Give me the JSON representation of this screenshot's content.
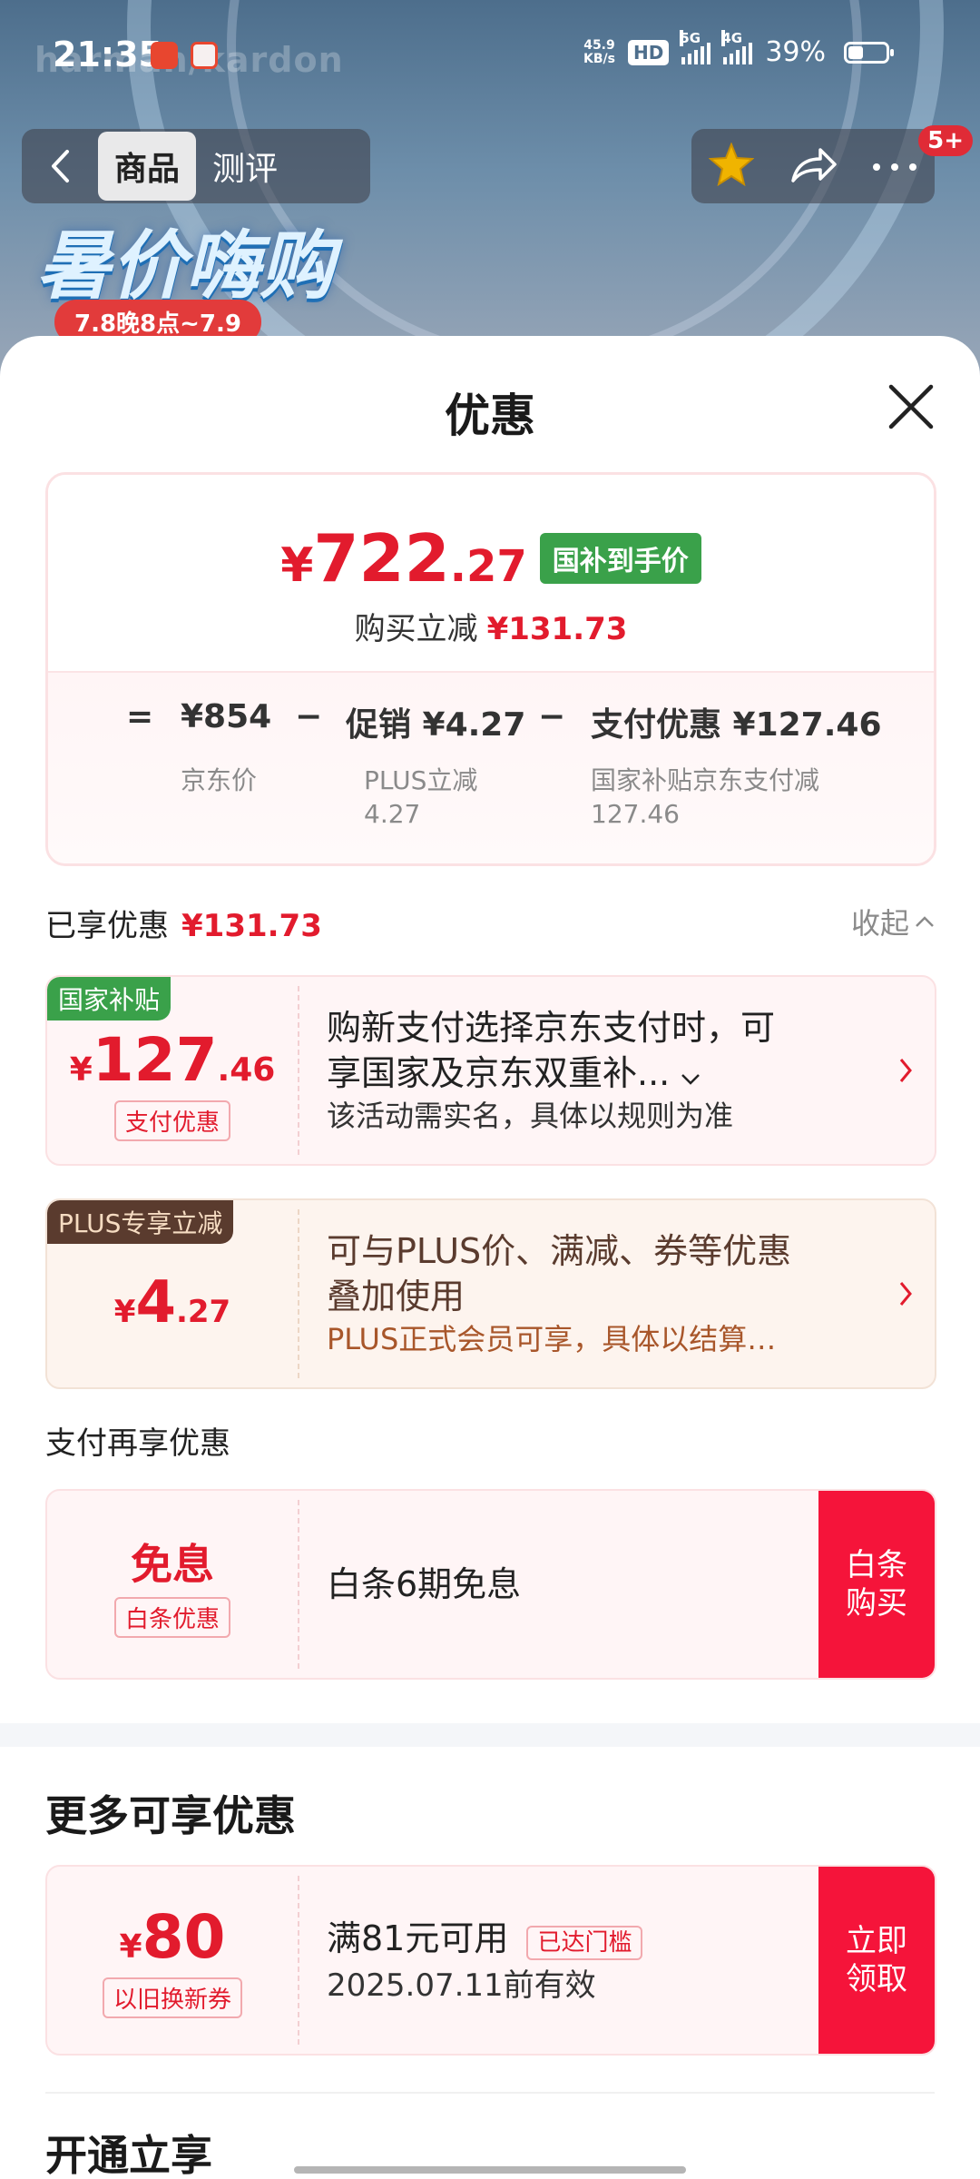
{
  "status_bar": {
    "time": "21:35",
    "net_speed_top": "45.9",
    "net_speed_bottom": "KB/s",
    "hd": "HD",
    "sig1": "5G",
    "sig2": "4G",
    "battery": "39%",
    "battery_level": 0.39
  },
  "background": {
    "brand": "harman/kardon",
    "promo_title": "暑价嗨购",
    "promo_tag": "7.8晚8点~7.9"
  },
  "nav": {
    "tabs": [
      {
        "label": "商品",
        "active": true
      },
      {
        "label": "测评",
        "active": false
      }
    ],
    "badge": "5+"
  },
  "sheet": {
    "title": "优惠",
    "price_card": {
      "currency": "¥",
      "price_int": "722",
      "price_dec": ".27",
      "tag": "国补到手价",
      "reduce_label": "购买立减",
      "reduce_amount": "¥131.73",
      "formula": {
        "eq": "=",
        "jd_price": "¥854",
        "minus1": "−",
        "promo": "促销 ¥4.27",
        "minus2": "−",
        "pay": "支付优惠 ¥127.46",
        "jd_price_label": "京东价",
        "promo_sub_1": "PLUS立减",
        "promo_sub_2": "4.27",
        "pay_sub_1": "国家补贴京东支付减",
        "pay_sub_2": "127.46"
      }
    },
    "enjoyed_label": "已享优惠",
    "enjoyed_amount": "¥131.73",
    "collapse_label": "收起",
    "coupons": [
      {
        "corner": "国家补贴",
        "currency": "¥",
        "int": "127",
        "dec": ".46",
        "tag": "支付优惠",
        "line1": "购新支付选择京东支付时，可",
        "line2": "享国家及京东双重补...",
        "line3": "该活动需实名，具体以规则为准"
      },
      {
        "corner": "PLUS专享立减",
        "currency": "¥",
        "int": "4",
        "dec": ".27",
        "line1": "可与PLUS价、满减、券等优惠",
        "line2": "叠加使用",
        "line3": "PLUS正式会员可享，具体以结算…"
      }
    ],
    "pay_more_label": "支付再享优惠",
    "baitiao": {
      "main": "免息",
      "tag": "白条优惠",
      "desc": "白条6期免息",
      "btn": "白条购买"
    },
    "more_heading": "更多可享优惠",
    "coupon_80": {
      "currency": "¥",
      "amount": "80",
      "tag": "以旧换新券",
      "condition": "满81元可用",
      "badge": "已达门槛",
      "valid": "2025.07.11前有效",
      "btn": "立即领取"
    },
    "open_heading": "开通立享"
  },
  "colors": {
    "accent_red": "#e21b2d",
    "subsidy_green": "#3aa14a",
    "button_red": "#f5143a",
    "plus_brown": "#5a3b2e"
  }
}
